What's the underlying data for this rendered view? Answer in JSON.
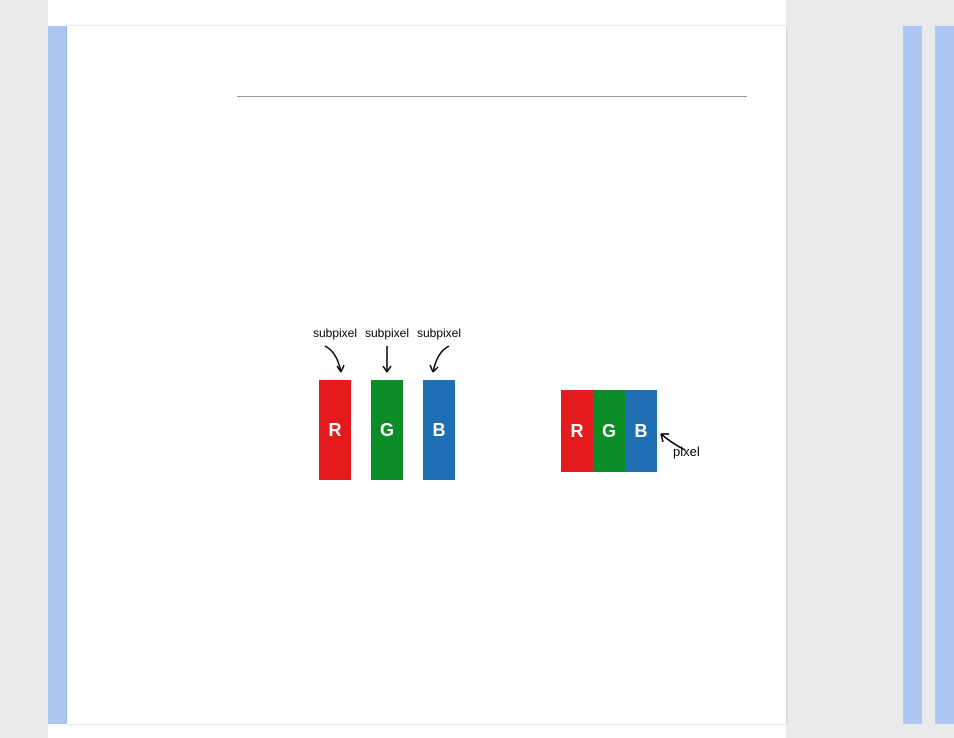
{
  "labels": {
    "subpixel1": "subpixel",
    "subpixel2": "subpixel",
    "subpixel3": "subpixel",
    "pixel": "pixel"
  },
  "subpixels": {
    "r": "R",
    "g": "G",
    "b": "B"
  },
  "colors": {
    "r": "#e41a1c",
    "g": "#0a8d26",
    "b": "#1f6fb4",
    "panel": "#e8e9eb",
    "strip": "#aec6f4"
  }
}
